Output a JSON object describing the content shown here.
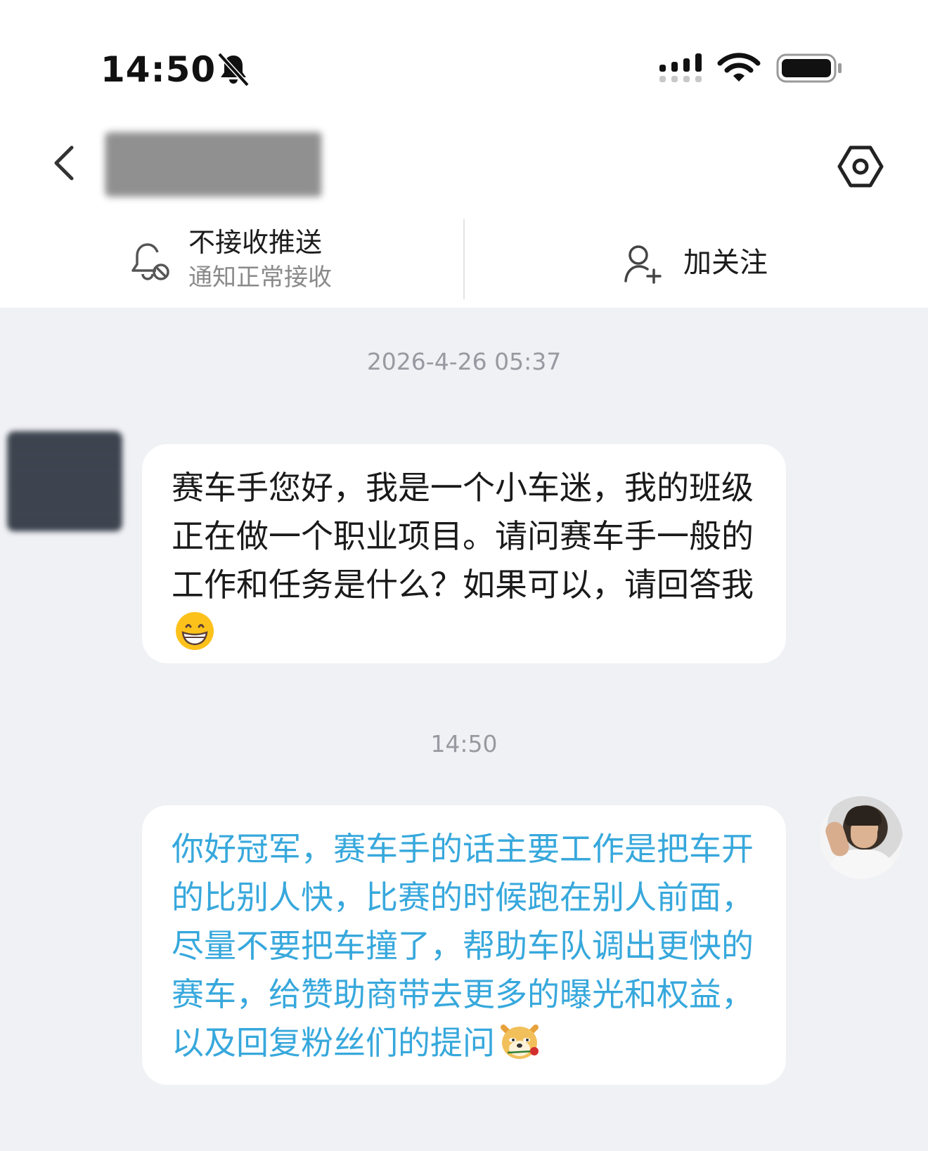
{
  "status_bar": {
    "time": "14:50",
    "icons": [
      "bell-slash-icon",
      "cellular-signal-icon",
      "wifi-icon",
      "battery-icon"
    ]
  },
  "nav": {
    "back_icon": "chevron-left-icon",
    "settings_icon": "hexagon-settings-icon"
  },
  "actions": {
    "notify": {
      "title": "不接收推送",
      "subtitle": "通知正常接收",
      "icon": "bell-muted-icon"
    },
    "follow": {
      "label": "加关注",
      "icon": "add-user-icon"
    }
  },
  "messages": [
    {
      "timestamp": "2026-4-26 05:37",
      "direction": "incoming",
      "text": "赛车手您好，我是一个小车迷，我的班级正在做一个职业项目。请问赛车手一般的工作和任务是什么？如果可以，请回答我",
      "emoji": "grinning-face"
    },
    {
      "timestamp": "14:50",
      "direction": "outgoing",
      "text": "你好冠军，赛车手的话主要工作是把车开的比别人快，比赛的时候跑在别人前面，尽量不要把车撞了，帮助车队调出更快的赛车，给赞助商带去更多的曝光和权益，以及回复粉丝们的提问",
      "emoji": "doge-with-rose"
    }
  ],
  "colors": {
    "background": "#f0f1f5",
    "bubble": "#ffffff",
    "outgoing_text": "#37a8dc",
    "timestamp": "#979aa0"
  }
}
